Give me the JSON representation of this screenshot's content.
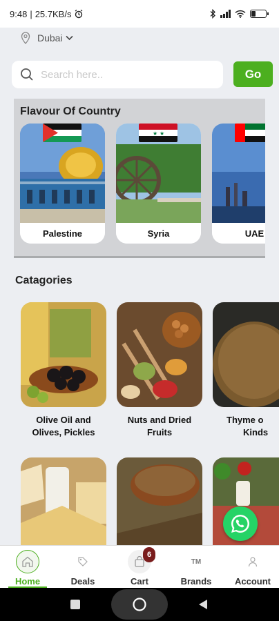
{
  "status_bar": {
    "time": "9:48",
    "speed": "25.7KB/s"
  },
  "location": {
    "city": "Dubai"
  },
  "search": {
    "placeholder": "Search here..",
    "go_label": "Go"
  },
  "flavour": {
    "title": "Flavour Of Country",
    "countries": [
      {
        "name": "Palestine"
      },
      {
        "name": "Syria"
      },
      {
        "name": "UAE"
      }
    ]
  },
  "categories": {
    "title": "Catagories",
    "items": [
      {
        "name_line1": "Olive Oil and",
        "name_line2": "Olives, Pickles"
      },
      {
        "name_line1": "Nuts and Dried",
        "name_line2": "Fruits"
      },
      {
        "name_line1": "Thyme o",
        "name_line2": "Kinds"
      }
    ]
  },
  "bottom_nav": {
    "items": [
      {
        "label": "Home",
        "icon": "home-icon"
      },
      {
        "label": "Deals",
        "icon": "tag-icon"
      },
      {
        "label": "Cart",
        "icon": "shopping-bag-icon"
      },
      {
        "label": "Brands",
        "icon": "trademark-icon"
      },
      {
        "label": "Account",
        "icon": "user-icon"
      }
    ],
    "cart_count": "6",
    "brands_glyph": "TM"
  },
  "colors": {
    "accent": "#4caf1f",
    "badge": "#7a1d1d",
    "whatsapp": "#25d366"
  }
}
